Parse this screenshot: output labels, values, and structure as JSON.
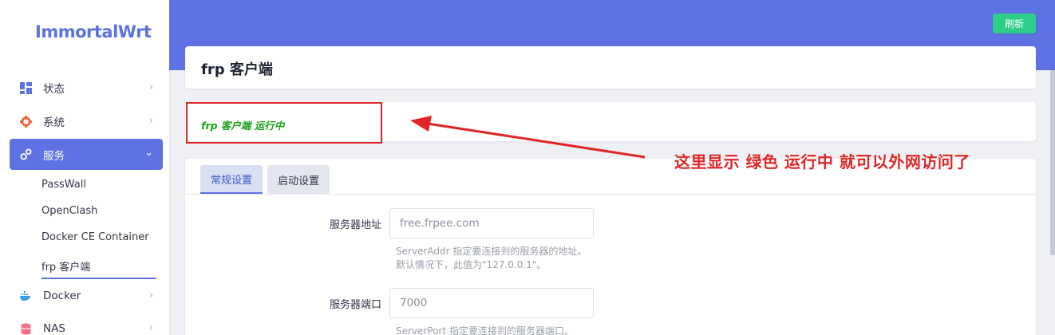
{
  "brand": "ImmortalWrt",
  "sidebar": {
    "items": [
      {
        "label": "状态",
        "icon": "dashboard-icon"
      },
      {
        "label": "系统",
        "icon": "gear-icon"
      },
      {
        "label": "服务",
        "icon": "services-icon"
      },
      {
        "label": "Docker",
        "icon": "docker-icon"
      },
      {
        "label": "NAS",
        "icon": "database-icon"
      }
    ],
    "subitems": [
      "PassWall",
      "OpenClash",
      "Docker CE Container",
      "frp 客户端"
    ]
  },
  "header": {
    "refresh_label": "刷新"
  },
  "page": {
    "title": "frp 客户端",
    "status": "frp 客户端 运行中"
  },
  "tabs": [
    "常规设置",
    "启动设置"
  ],
  "form": {
    "server_addr": {
      "label": "服务器地址",
      "value": "free.frpee.com",
      "hint1": "ServerAddr 指定要连接到的服务器的地址。",
      "hint2": "默认情况下，此值为\"127.0.0.1\"。"
    },
    "server_port": {
      "label": "服务器端口",
      "value": "7000",
      "hint1": "ServerPort 指定要连接到的服务器端口。"
    }
  },
  "annotation": "这里显示 绿色 运行中 就可以外网访问了",
  "colors": {
    "accent": "#5e72e4",
    "success": "#2dce89",
    "running": "#1aa01a",
    "annotation": "#e02626"
  }
}
